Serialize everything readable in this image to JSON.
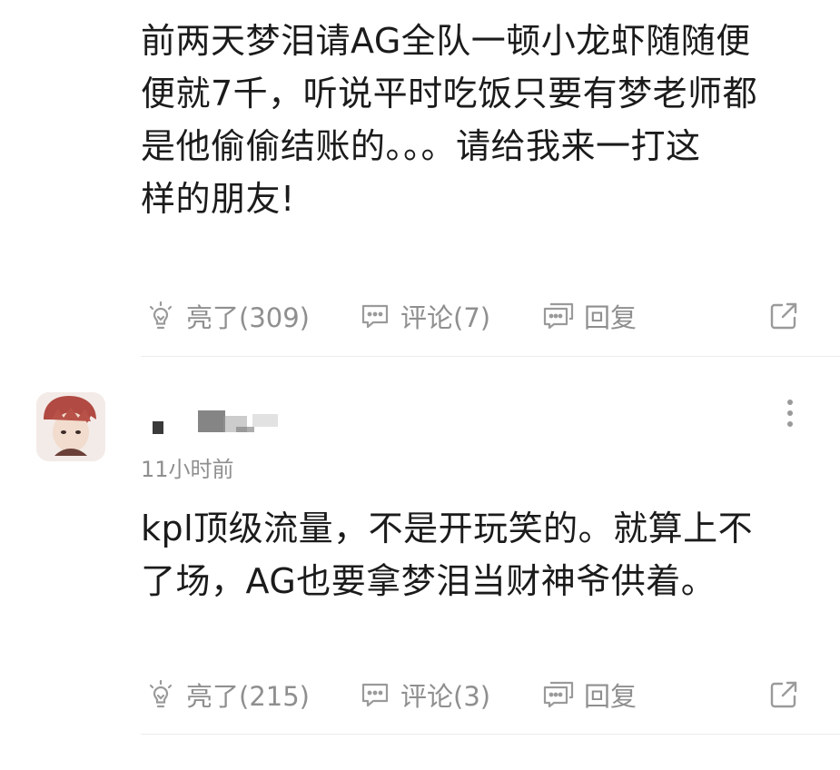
{
  "comment1": {
    "text_lines": [
      "前两天梦泪请AG全队一顿小龙虾随随便",
      "便就7千，听说平时吃饭只要有梦老师都",
      "是他偷偷结账的。。。请给我来一打这",
      "样的朋友!"
    ],
    "like_label": "亮了(309)",
    "comment_label": "评论(7)",
    "reply_label": "回复"
  },
  "comment2": {
    "username": "",
    "timestamp": "11小时前",
    "text_lines": [
      "kpl顶级流量，不是开玩笑的。就算上不",
      "了场，AG也要拿梦泪当财神爷供着。"
    ],
    "like_label": "亮了(215)",
    "comment_label": "评论(3)",
    "reply_label": "回复"
  },
  "icons": {
    "like": "lightbulb-icon",
    "comment": "chat-bubble-icon",
    "reply": "double-chat-icon",
    "share": "share-icon",
    "more": "more-vertical-icon"
  },
  "colors": {
    "text": "#1b1b1b",
    "muted": "#8f8f8f",
    "divider": "#ececec"
  }
}
